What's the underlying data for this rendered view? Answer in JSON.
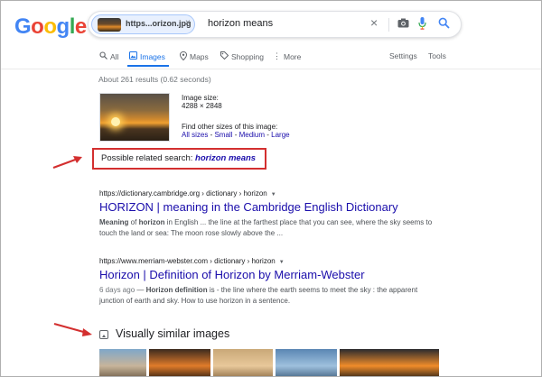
{
  "logo": {
    "letters": [
      "G",
      "o",
      "o",
      "g",
      "l",
      "e"
    ],
    "colors": [
      "#4285f4",
      "#ea4335",
      "#fbbc05",
      "#4285f4",
      "#34a853",
      "#ea4335"
    ]
  },
  "search": {
    "chip_label": "https...orizon.jpg",
    "chip_close": "×",
    "query": "horizon means",
    "clear_icon": "×",
    "camera_icon": "camera-icon",
    "mic_icon": "mic-icon",
    "search_icon": "search-icon",
    "accent": "#1a73e8"
  },
  "tabs": [
    {
      "label": "All",
      "icon": "search-icon",
      "active": false
    },
    {
      "label": "Images",
      "icon": "image-icon",
      "active": true
    },
    {
      "label": "Maps",
      "icon": "map-pin-icon",
      "active": false
    },
    {
      "label": "Shopping",
      "icon": "tag-icon",
      "active": false
    },
    {
      "label": "More",
      "icon": "more-vert-icon",
      "active": false
    }
  ],
  "header_links": {
    "settings": "Settings",
    "tools": "Tools"
  },
  "stats": "About 261 results (0.62 seconds)",
  "query_image": {
    "size_label": "Image size:",
    "size_value": "4288 × 2848",
    "other_sizes": "Find other sizes of this image:",
    "links": [
      "All sizes",
      "Small",
      "Medium",
      "Large"
    ],
    "separator": " - "
  },
  "related": {
    "prefix": "Possible related search:",
    "link": "horizon means",
    "box_color": "#d32f2f"
  },
  "results": [
    {
      "cite": "https://dictionary.cambridge.org › dictionary › horizon",
      "title": "HORIZON | meaning in the Cambridge English Dictionary",
      "snippet_parts": [
        {
          "b": "Meaning"
        },
        {
          "t": " of "
        },
        {
          "b": "horizon"
        },
        {
          "t": " in English ... the line at the farthest place that you can see, where the sky seems to touch the land or sea: The moon rose slowly above the ..."
        }
      ]
    },
    {
      "cite": "https://www.merriam-webster.com › dictionary › horizon",
      "title": "Horizon | Definition of Horizon by Merriam-Webster",
      "snippet_parts": [
        {
          "d": "6 days ago"
        },
        {
          "t": " — "
        },
        {
          "b": "Horizon definition"
        },
        {
          "t": " is - the line where the earth seems to meet the sky : the apparent junction of earth and sky. How to use horizon in a sentence."
        }
      ]
    }
  ],
  "similar": {
    "title": "Visually similar images",
    "thumbs": [
      {
        "colors": [
          "#7fa7c9",
          "#c7b49a",
          "#6b5a45"
        ]
      },
      {
        "colors": [
          "#3b2a1e",
          "#e07b2a",
          "#2a1c12"
        ]
      },
      {
        "colors": [
          "#c9a878",
          "#e8c89a",
          "#8a6a44"
        ]
      },
      {
        "colors": [
          "#5a86b3",
          "#9ec0dd",
          "#3f5f7e"
        ]
      },
      {
        "colors": [
          "#2a2a2e",
          "#f08c2a",
          "#1e1a16"
        ]
      }
    ]
  },
  "annotation_arrow_color": "#d32f2f"
}
